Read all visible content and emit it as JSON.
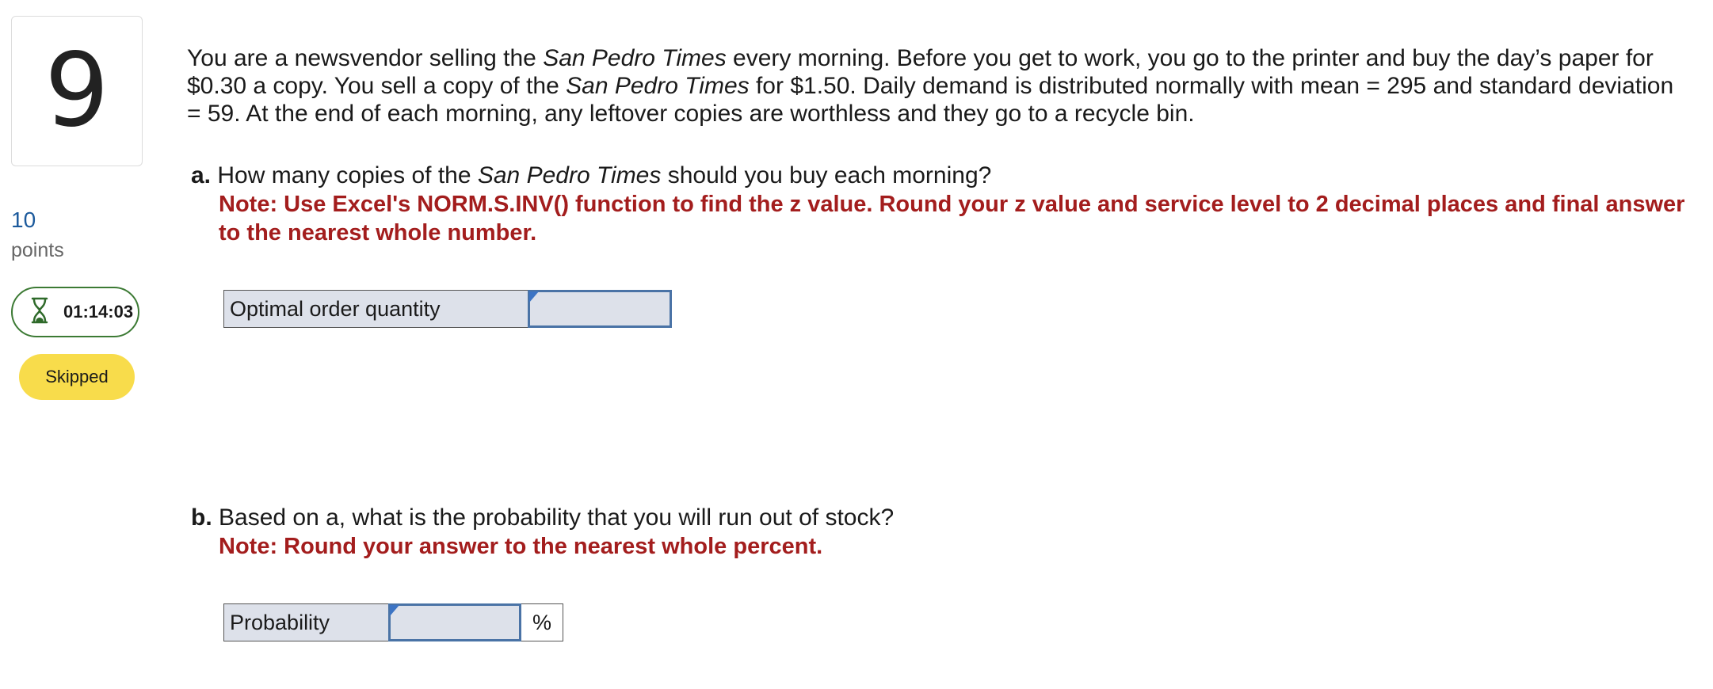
{
  "question": {
    "number": "9",
    "points_value": "10",
    "points_label": "points",
    "timer": "01:14:03",
    "status": "Skipped"
  },
  "intro": {
    "t1": "You are a newsvendor selling the ",
    "i1": "San Pedro Times",
    "t2": " every morning. Before you get to work, you go to the printer and buy the day’s paper for $0.30 a copy. You sell a copy of the ",
    "i2": "San Pedro Times",
    "t3": " for $1.50. Daily demand is distributed normally with mean = 295 and standard deviation = 59. At the end of each morning, any leftover copies are worthless and they go to a recycle bin."
  },
  "part_a": {
    "letter": "a.",
    "q1": " How many copies of the ",
    "q_italic": "San Pedro Times",
    "q2": " should you buy each morning?",
    "note": "Note: Use Excel's NORM.S.INV() function to find the z value. Round your z value and service level to 2 decimal places and final answer to the nearest whole number.",
    "row_label": "Optimal order quantity",
    "answer_value": ""
  },
  "part_b": {
    "letter": "b.",
    "question": " Based on a, what is the probability that you will run out of stock?",
    "note": "Note: Round your answer to the nearest whole percent.",
    "row_label": "Probability",
    "answer_value": "",
    "unit": "%"
  },
  "colors": {
    "note_red": "#a31d1d",
    "points_blue": "#1c5a9c",
    "timer_green": "#3c7a34",
    "skipped_yellow": "#f8dc4b",
    "input_border": "#4a73a6",
    "cell_bg": "#dde1ea"
  },
  "icons": {
    "timer": "hourglass-icon",
    "input_flag": "input-flag-icon"
  }
}
